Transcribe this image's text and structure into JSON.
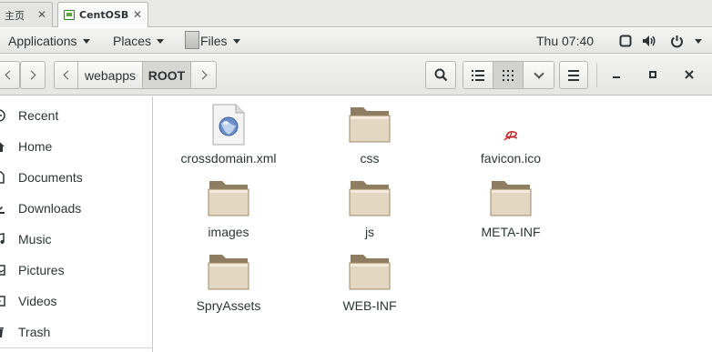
{
  "vm_tabs": [
    {
      "label": "主页",
      "close": "✕"
    },
    {
      "label": "CentOSB",
      "close": "✕"
    }
  ],
  "topbar": {
    "applications": "Applications",
    "places": "Places",
    "files": "Files",
    "clock": "Thu 07:40"
  },
  "breadcrumb": {
    "items": [
      "webapps",
      "ROOT"
    ]
  },
  "sidebar": {
    "items": [
      {
        "label": "Recent",
        "icon": "clock-icon"
      },
      {
        "label": "Home",
        "icon": "home-icon"
      },
      {
        "label": "Documents",
        "icon": "document-icon"
      },
      {
        "label": "Downloads",
        "icon": "download-icon"
      },
      {
        "label": "Music",
        "icon": "music-icon"
      },
      {
        "label": "Pictures",
        "icon": "picture-icon"
      },
      {
        "label": "Videos",
        "icon": "video-icon"
      },
      {
        "label": "Trash",
        "icon": "trash-icon"
      }
    ]
  },
  "files": [
    {
      "name": "crossdomain.xml",
      "type": "xml-file"
    },
    {
      "name": "css",
      "type": "folder"
    },
    {
      "name": "favicon.ico",
      "type": "image-file"
    },
    {
      "name": "images",
      "type": "folder"
    },
    {
      "name": "js",
      "type": "folder"
    },
    {
      "name": "META-INF",
      "type": "folder"
    },
    {
      "name": "SpryAssets",
      "type": "folder"
    },
    {
      "name": "WEB-INF",
      "type": "folder"
    }
  ]
}
